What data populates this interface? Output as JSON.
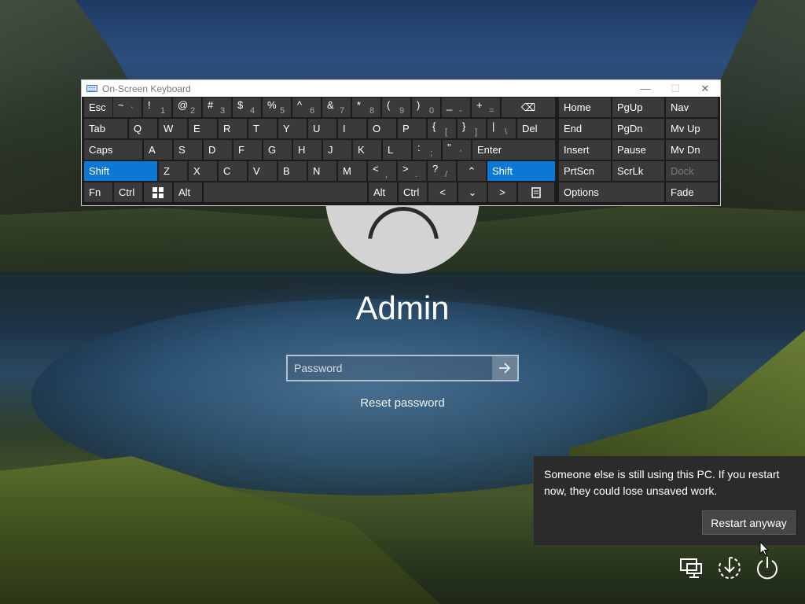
{
  "osk": {
    "title": "On-Screen Keyboard",
    "minimize": "—",
    "maximize": "☐",
    "close": "✕",
    "rows": {
      "r1": [
        {
          "label": "Esc"
        },
        {
          "top": "~",
          "bot": "`"
        },
        {
          "top": "!",
          "bot": "1"
        },
        {
          "top": "@",
          "bot": "2"
        },
        {
          "top": "#",
          "bot": "3"
        },
        {
          "top": "$",
          "bot": "4"
        },
        {
          "top": "%",
          "bot": "5"
        },
        {
          "top": "^",
          "bot": "6"
        },
        {
          "top": "&",
          "bot": "7"
        },
        {
          "top": "*",
          "bot": "8"
        },
        {
          "top": "(",
          "bot": "9"
        },
        {
          "top": ")",
          "bot": "0"
        },
        {
          "top": "_",
          "bot": "-"
        },
        {
          "top": "+",
          "bot": "="
        },
        {
          "label": "⌫"
        }
      ],
      "r2": [
        {
          "label": "Tab"
        },
        {
          "label": "Q"
        },
        {
          "label": "W"
        },
        {
          "label": "E"
        },
        {
          "label": "R"
        },
        {
          "label": "T"
        },
        {
          "label": "Y"
        },
        {
          "label": "U"
        },
        {
          "label": "I"
        },
        {
          "label": "O"
        },
        {
          "label": "P"
        },
        {
          "top": "{",
          "bot": "["
        },
        {
          "top": "}",
          "bot": "]"
        },
        {
          "top": "|",
          "bot": "\\"
        },
        {
          "label": "Del"
        }
      ],
      "r3": [
        {
          "label": "Caps"
        },
        {
          "label": "A"
        },
        {
          "label": "S"
        },
        {
          "label": "D"
        },
        {
          "label": "F"
        },
        {
          "label": "G"
        },
        {
          "label": "H"
        },
        {
          "label": "J"
        },
        {
          "label": "K"
        },
        {
          "label": "L"
        },
        {
          "top": ":",
          "bot": ";"
        },
        {
          "top": "\"",
          "bot": "'"
        },
        {
          "label": "Enter"
        }
      ],
      "r4": [
        {
          "label": "Shift"
        },
        {
          "label": "Z"
        },
        {
          "label": "X"
        },
        {
          "label": "C"
        },
        {
          "label": "V"
        },
        {
          "label": "B"
        },
        {
          "label": "N"
        },
        {
          "label": "M"
        },
        {
          "top": "<",
          "bot": ","
        },
        {
          "top": ">",
          "bot": "."
        },
        {
          "top": "?",
          "bot": "/"
        },
        {
          "label": "⌃"
        },
        {
          "label": "Shift"
        }
      ],
      "r5": [
        {
          "label": "Fn"
        },
        {
          "label": "Ctrl"
        },
        {
          "label": "win-logo-icon"
        },
        {
          "label": "Alt"
        },
        {
          "label": ""
        },
        {
          "label": "Alt"
        },
        {
          "label": "Ctrl"
        },
        {
          "label": "<"
        },
        {
          "label": "⌄"
        },
        {
          "label": ">"
        },
        {
          "label": "menu-icon"
        }
      ]
    },
    "nav": [
      [
        "Home",
        "PgUp",
        "Nav"
      ],
      [
        "End",
        "PgDn",
        "Mv Up"
      ],
      [
        "Insert",
        "Pause",
        "Mv Dn"
      ],
      [
        "PrtScn",
        "ScrLk",
        "Dock"
      ],
      [
        "Options",
        "Fade"
      ]
    ],
    "colors": {
      "active": "#0a78d4",
      "key": "#3a3a3a",
      "bg": "#1c1c1c"
    }
  },
  "login": {
    "user_name": "Admin",
    "password_placeholder": "Password",
    "reset_link": "Reset password"
  },
  "flyout": {
    "message": "Someone else is still using this PC. If you restart now, they could lose unsaved work.",
    "restart_button": "Restart anyway"
  },
  "system_icons": [
    "network-icon",
    "accessibility-icon",
    "power-icon"
  ]
}
